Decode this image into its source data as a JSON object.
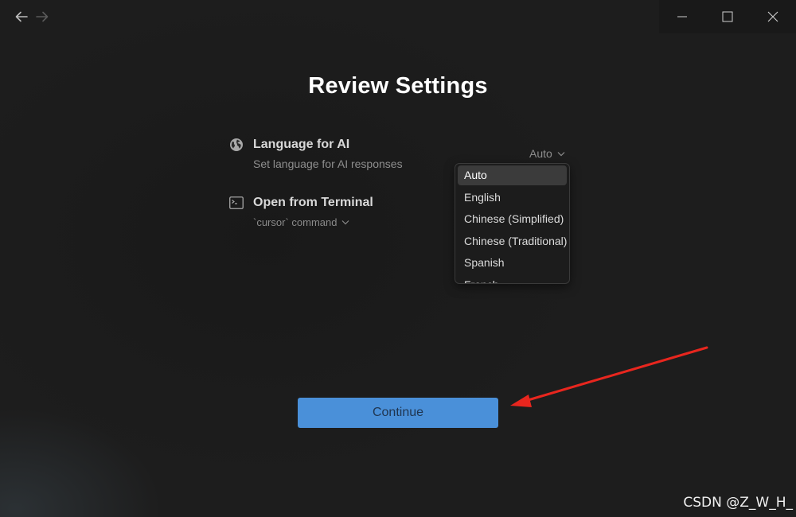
{
  "page": {
    "title": "Review Settings"
  },
  "settings": {
    "language": {
      "title": "Language for AI",
      "description": "Set language for AI responses",
      "selected": "Auto",
      "options": [
        "Auto",
        "English",
        "Chinese (Simplified)",
        "Chinese (Traditional)",
        "Spanish",
        "French"
      ]
    },
    "terminal": {
      "title": "Open from Terminal",
      "command_label": "`cursor` command"
    }
  },
  "actions": {
    "continue_label": "Continue"
  },
  "watermark": "CSDN @Z_W_H_",
  "icons": {
    "back": "arrow-left-icon",
    "forward": "arrow-right-icon",
    "minimize": "minimize-icon",
    "maximize": "maximize-icon",
    "close": "close-icon",
    "language": "globe-icon",
    "terminal": "terminal-icon"
  },
  "colors": {
    "background": "#1d1d1d",
    "accent": "#4a90d9",
    "annotation_arrow": "#e8261e"
  }
}
